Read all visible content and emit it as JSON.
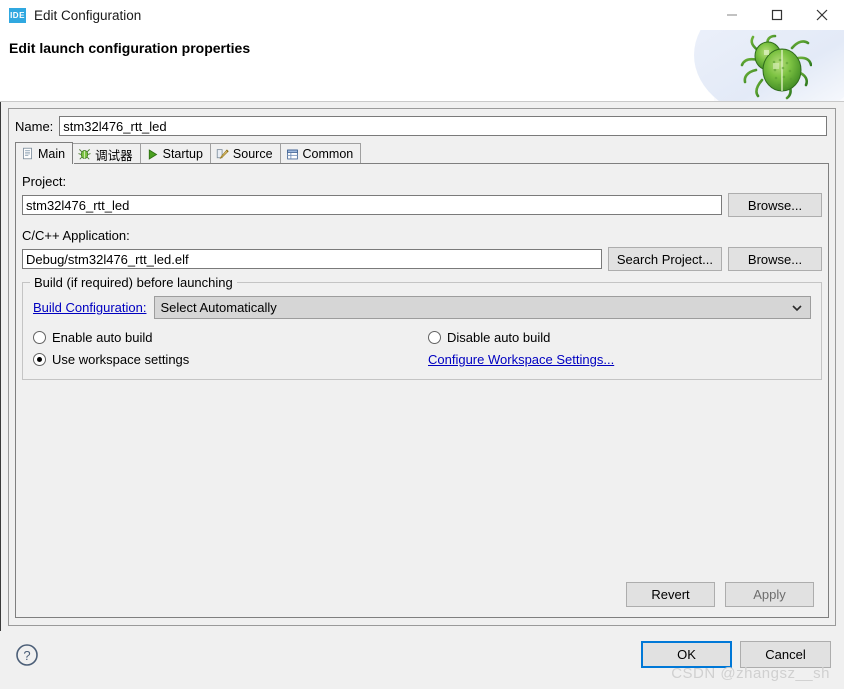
{
  "window": {
    "app_icon_label": "IDE",
    "title": "Edit Configuration",
    "minimize_label": "–",
    "maximize_label": "□",
    "close_label": "✕"
  },
  "banner": {
    "heading": "Edit launch configuration properties",
    "graphic": "green-bug"
  },
  "name_field": {
    "label": "Name:",
    "value": "stm32l476_rtt_led",
    "placeholder": ""
  },
  "tabs": [
    {
      "label": "Main",
      "icon": "document-icon",
      "active": true
    },
    {
      "label": "调试器",
      "icon": "debugger-icon",
      "active": false
    },
    {
      "label": "Startup",
      "icon": "play-icon",
      "active": false
    },
    {
      "label": "Source",
      "icon": "source-edit-icon",
      "active": false
    },
    {
      "label": "Common",
      "icon": "common-table-icon",
      "active": false
    }
  ],
  "main_tab": {
    "project": {
      "label": "Project:",
      "value": "stm32l476_rtt_led",
      "browse_label": "Browse..."
    },
    "application": {
      "label": "C/C++ Application:",
      "value": "Debug/stm32l476_rtt_led.elf",
      "search_label": "Search Project...",
      "browse_label": "Browse..."
    },
    "build_group": {
      "title": "Build (if required) before launching",
      "build_configuration_link": "Build Configuration:",
      "build_configuration_value": "Select Automatically",
      "options": [
        {
          "label": "Enable auto build",
          "checked": false
        },
        {
          "label": "Disable auto build",
          "checked": false
        },
        {
          "label": "Use workspace settings",
          "checked": true
        }
      ],
      "configure_workspace_link": "Configure Workspace Settings..."
    }
  },
  "actions": {
    "revert_label": "Revert",
    "apply_label": "Apply",
    "ok_label": "OK",
    "cancel_label": "Cancel",
    "help_tooltip": "?"
  },
  "watermark": "CSDN @zhangsz__sh",
  "colors": {
    "accent": "#0078d7",
    "app_icon_bg": "#30a8e0",
    "link": "#0000c0",
    "dialog_bg": "#f0f0f0"
  }
}
